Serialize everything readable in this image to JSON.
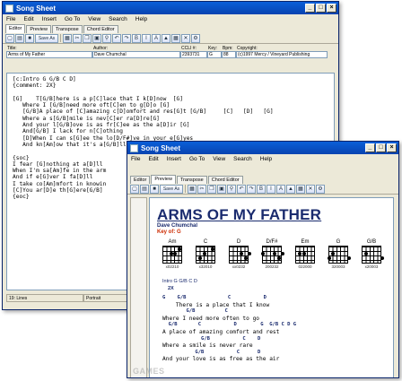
{
  "back": {
    "title": "Song Sheet",
    "menu": [
      "File",
      "Edit",
      "Insert",
      "Go To",
      "View",
      "Search",
      "Help"
    ],
    "tabs": [
      "Editor",
      "Preview",
      "Transpose",
      "Chord Editor"
    ],
    "save_label": "Save As",
    "fields": {
      "title_label": "Title:",
      "title_value": "Arms of My Father",
      "author_label": "Author:",
      "author_value": "Dave Chumchal",
      "ccli_label": "CCLI #:",
      "ccli_value": "2393731",
      "key_label": "Key:",
      "key_value": "G",
      "bpm_label": "Bpm:",
      "bpm_value": "88",
      "copyright_label": "Copyright:",
      "copyright_value": "(c)1997 Mercy / Vineyard Publishing"
    },
    "editor_lines": [
      "[c:Intro G G/B C D]",
      "{comment: 2X}",
      "",
      "[G]    T[G/B]here is a p[C]lace that I k[D]now  [G]",
      "   Where I [G/B]need more oft[C]en to g[D]o [G]",
      "   [G/B]A place of [C]amazing c[D]omfort and res[G]t [G/B]     [C]   [D]   [G]",
      "   Where a s[G/B]mile is nev[C]er ra[D]re[G]",
      "   And your l[G/B]ove is as fr[C]ee as the a[D]ir [G]",
      "   And[G/B] I lack for n[C]othing",
      "   [D]When I can s[G]ee the lo[D/F#]ve in your e[G]yes",
      "   And kn[Am]ow that it's a[G/B]ll for[C] m[D]e",
      "",
      "{soc}",
      "I fear [G]nothing at a[D]ll",
      "When I'm sa[Am]fe in the arm",
      "And if e[G]ver I fa[D]ll",
      "I take co[Am]mfort in knowin",
      "[C]You ar[D]e th[G]ere[G/B]",
      "{eoc}"
    ],
    "status": [
      "19: Lines",
      "Portrait"
    ]
  },
  "front": {
    "title": "Song Sheet",
    "menu": [
      "File",
      "Edit",
      "Insert",
      "Go To",
      "View",
      "Search",
      "Help"
    ],
    "tabs": [
      "Editor",
      "Preview",
      "Transpose",
      "Chord Editor"
    ],
    "save_label": "Save As",
    "song_title": "ARMS OF MY FATHER",
    "artist": "Dave Chumchal",
    "key": "Key of: G",
    "chords": [
      {
        "name": "Am",
        "fingers": "x02210"
      },
      {
        "name": "C",
        "fingers": "x32010"
      },
      {
        "name": "D",
        "fingers": "xx0232"
      },
      {
        "name": "D/F#",
        "fingers": "200232"
      },
      {
        "name": "Em",
        "fingers": "022000"
      },
      {
        "name": "G",
        "fingers": "320003"
      },
      {
        "name": "G/B",
        "fingers": "x20003"
      }
    ],
    "intro_line": "Intro G G/B C D",
    "intro_repeat": "2X",
    "sheet": [
      {
        "type": "c",
        "text": "G    G/B              C           D"
      },
      {
        "type": "l",
        "text": "    There is a place that I know"
      },
      {
        "type": "c",
        "text": "        G/B          C"
      },
      {
        "type": "l",
        "text": "Where I need more often to go"
      },
      {
        "type": "c",
        "text": "  G/B       C           D        G  G/B C D G"
      },
      {
        "type": "l",
        "text": "A place of amazing comfort and rest"
      },
      {
        "type": "c",
        "text": "             G/B           C    D"
      },
      {
        "type": "l",
        "text": "Where a smile is never rare"
      },
      {
        "type": "c",
        "text": "           G/B           C      D"
      },
      {
        "type": "l",
        "text": "And your love is as free as the air"
      }
    ],
    "watermark": "GAMES"
  }
}
